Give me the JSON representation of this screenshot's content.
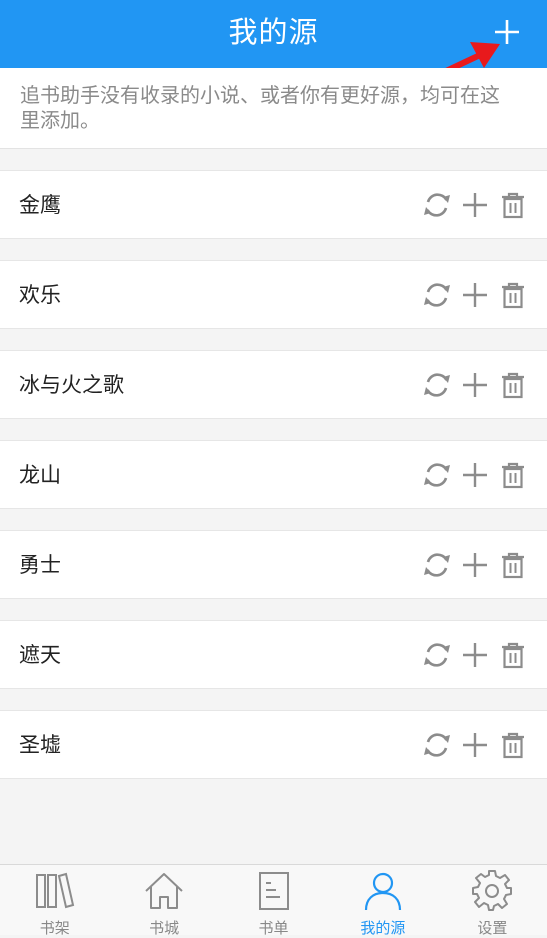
{
  "colors": {
    "accent": "#2196f3",
    "icon_gray": "#8c8c8c",
    "annotation_red": "#e8191c"
  },
  "header": {
    "title": "我的源",
    "add_icon": "plus-icon"
  },
  "notice": "追书助手没有收录的小说、或者你有更好源，均可在这里添加。",
  "sources": [
    {
      "name": "金鹰"
    },
    {
      "name": "欢乐"
    },
    {
      "name": "冰与火之歌"
    },
    {
      "name": "龙山"
    },
    {
      "name": "勇士"
    },
    {
      "name": "遮天"
    },
    {
      "name": "圣墟"
    }
  ],
  "row_icons": [
    "refresh-icon",
    "plus-icon",
    "trash-icon"
  ],
  "tabbar": {
    "items": [
      {
        "label": "书架",
        "icon": "bookshelf-icon"
      },
      {
        "label": "书城",
        "icon": "home-icon"
      },
      {
        "label": "书单",
        "icon": "list-icon"
      },
      {
        "label": "我的源",
        "icon": "user-icon",
        "active": true
      },
      {
        "label": "设置",
        "icon": "gear-icon"
      }
    ]
  }
}
